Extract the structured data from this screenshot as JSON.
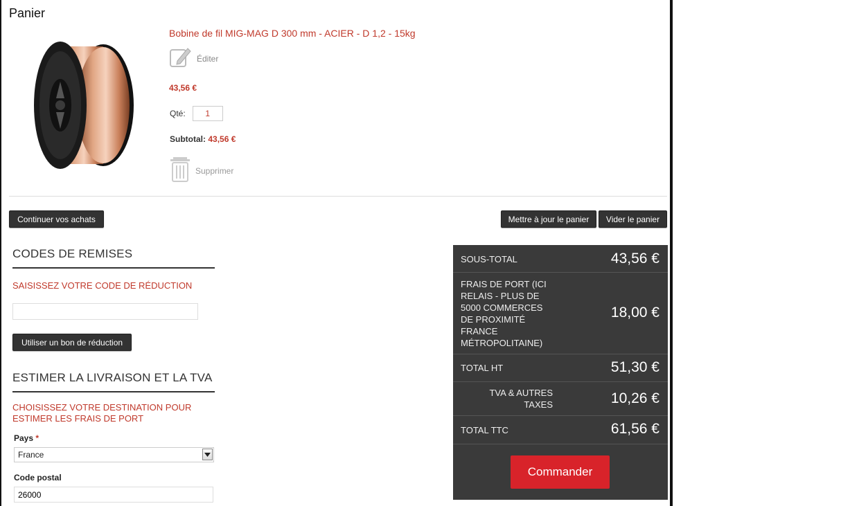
{
  "cart": {
    "title": "Panier",
    "product": {
      "name": "Bobine de fil MIG-MAG D 300 mm - ACIER - D 1,2 - 15kg",
      "edit_label": "Éditer",
      "price": "43,56 €",
      "qty_label": "Qté:",
      "qty_value": "1",
      "subtotal_label": "Subtotal:",
      "subtotal_value": "43,56 €",
      "delete_label": "Supprimer",
      "image_icon": "wire-spool-image"
    },
    "buttons": {
      "continue": "Continuer vos achats",
      "update": "Mettre à jour le panier",
      "empty": "Vider le panier"
    }
  },
  "discount": {
    "heading": "CODES DE REMISES",
    "label": "SAISISSEZ VOTRE CODE DE RÉDUCTION",
    "input_value": "",
    "button": "Utiliser un bon de réduction"
  },
  "shipping": {
    "heading": "ESTIMER LA LIVRAISON ET LA TVA",
    "label": "CHOISISSEZ VOTRE DESTINATION POUR ESTIMER LES FRAIS DE PORT",
    "country_label": "Pays",
    "required_mark": "*",
    "country_value": "France",
    "postcode_label": "Code postal",
    "postcode_value": "26000"
  },
  "totals": {
    "rows": [
      {
        "label": "SOUS-TOTAL",
        "value": "43,56 €"
      },
      {
        "label": "FRAIS DE PORT (ICI RELAIS - PLUS DE 5000 COMMERCES DE PROXIMITÉ FRANCE MÉTROPOLITAINE)",
        "value": "18,00 €"
      },
      {
        "label": "TOTAL HT",
        "value": "51,30 €"
      },
      {
        "label": "TVA & AUTRES TAXES",
        "value": "10,26 €"
      },
      {
        "label": "TOTAL TTC",
        "value": "61,56 €"
      }
    ],
    "checkout_button": "Commander"
  },
  "colors": {
    "accent_red": "#c0392b",
    "checkout_red": "#d8232a",
    "totals_bg": "#3a3a3a",
    "button_dark": "#333333"
  }
}
